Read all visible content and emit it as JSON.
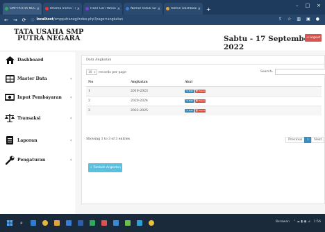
{
  "browser": {
    "tabs": [
      {
        "label": "SMP PUTRA NEGARA",
        "color": "#2eaa5c"
      },
      {
        "label": "Rhoma Irama - 41 Lagu",
        "color": "#e33"
      },
      {
        "label": "Hasil Cari Yahoo untuk min",
        "color": "#7b3fd0"
      },
      {
        "label": "Nomor Induk Siswa Nasional",
        "color": "#3a7bd5"
      },
      {
        "label": "Admin Dashboard Page",
        "color": "#e8a23a"
      }
    ],
    "url_host": "localhost",
    "url_path": "/smpputraneg/index.php?page=angkatan"
  },
  "header": {
    "brand_line1": "TATA USAHA SMP",
    "brand_line2": "PUTRA NEGARA",
    "date": "Sabtu - 17 September 2022",
    "logout_label": "Logout"
  },
  "sidebar": {
    "items": [
      {
        "label": "Dashboard",
        "icon": "home-icon",
        "chevron": false
      },
      {
        "label": "Master Data",
        "icon": "table-icon",
        "chevron": true
      },
      {
        "label": "Input Pembayaran",
        "icon": "money-icon",
        "chevron": true
      },
      {
        "label": "Transaksi",
        "icon": "balance-scale-icon",
        "chevron": true
      },
      {
        "label": "Laporan",
        "icon": "file-icon",
        "chevron": true
      },
      {
        "label": "Pengaturan",
        "icon": "wrench-icon",
        "chevron": true
      }
    ]
  },
  "panel": {
    "title": "Data Angkatan",
    "length_value": "10",
    "length_suffix": "records per page",
    "search_label": "Search:",
    "columns": [
      "No",
      "Angkatan",
      "Aksi"
    ],
    "rows": [
      {
        "no": "1",
        "angkatan": "2019-2023"
      },
      {
        "no": "2",
        "angkatan": "2020-2024"
      },
      {
        "no": "3",
        "angkatan": "2022-2025"
      }
    ],
    "edit_label": "Edit",
    "hapus_label": "Hapus",
    "info": "Showing 1 to 3 of 3 entries",
    "prev_label": "Previous",
    "page": "1",
    "next_label": "Next",
    "add_label": "+ Tambah Angkatan"
  },
  "taskbar": {
    "weather": "Berawan",
    "time": "1:56"
  }
}
